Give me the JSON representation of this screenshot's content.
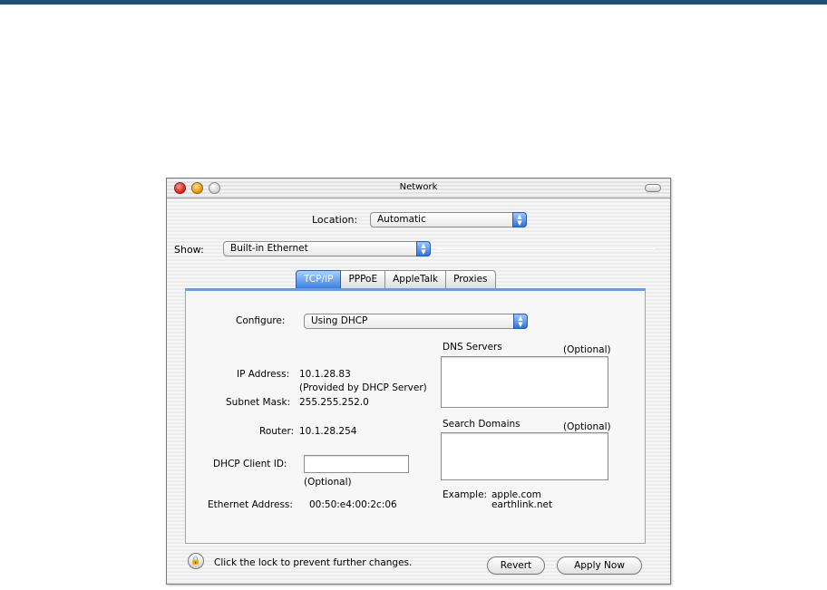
{
  "window": {
    "title": "Network"
  },
  "location": {
    "label": "Location:",
    "value": "Automatic"
  },
  "show": {
    "label": "Show:",
    "value": "Built-in Ethernet"
  },
  "tabs": [
    {
      "label": "TCP/IP",
      "active": true
    },
    {
      "label": "PPPoE",
      "active": false
    },
    {
      "label": "AppleTalk",
      "active": false
    },
    {
      "label": "Proxies",
      "active": false
    }
  ],
  "tcpip": {
    "configure_label": "Configure:",
    "configure_value": "Using DHCP",
    "ip_label": "IP Address:",
    "ip_value": "10.1.28.83",
    "ip_note": "(Provided by DHCP Server)",
    "subnet_label": "Subnet Mask:",
    "subnet_value": "255.255.252.0",
    "router_label": "Router:",
    "router_value": "10.1.28.254",
    "dhcp_label": "DHCP Client ID:",
    "dhcp_value": "",
    "dhcp_note": "(Optional)",
    "ethernet_label": "Ethernet Address:",
    "ethernet_value": "00:50:e4:00:2c:06",
    "dns_label": "DNS Servers",
    "dns_optional": "(Optional)",
    "search_label": "Search Domains",
    "search_optional": "(Optional)",
    "example_label": "Example:",
    "example_line1": "apple.com",
    "example_line2": "earthlink.net"
  },
  "footer": {
    "lock_text": "Click the lock to prevent further changes.",
    "revert_label": "Revert",
    "apply_label": "Apply Now"
  },
  "icons": {
    "popup_arrows": "▲▼",
    "lock": "🔒"
  },
  "colors": {
    "header_rule": "#274f72",
    "accent_blue": "#3a82e0"
  }
}
